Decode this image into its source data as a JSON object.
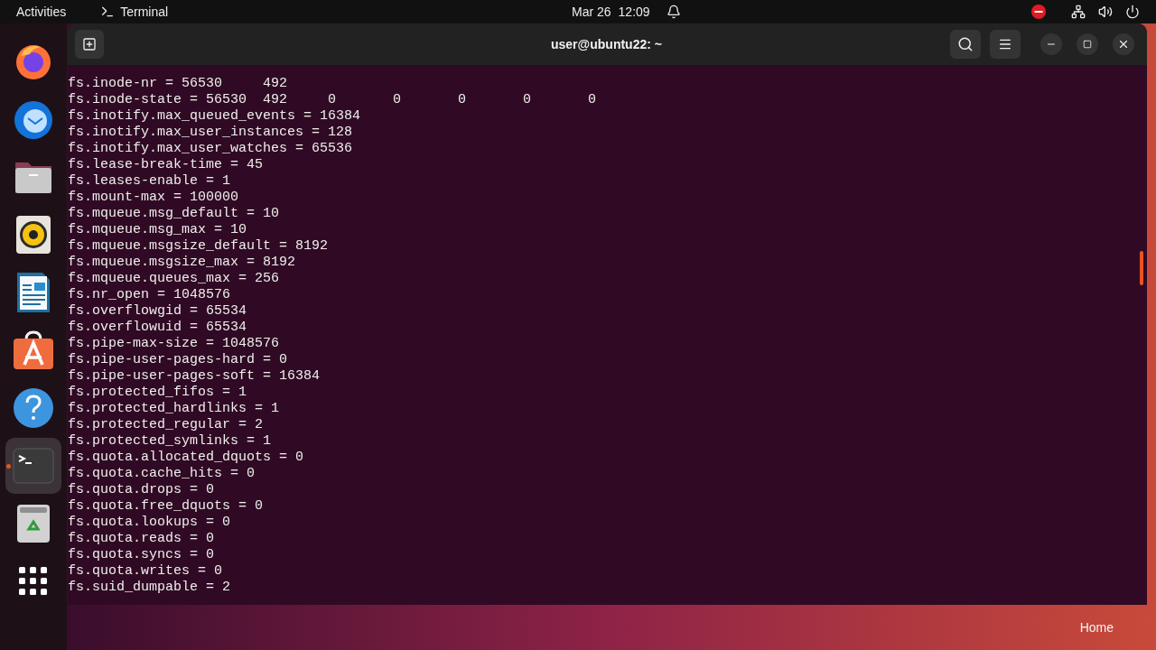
{
  "top_bar": {
    "activities": "Activities",
    "app_menu": "Terminal",
    "date": "Mar 26",
    "time": "12:09"
  },
  "dock": [
    {
      "kind": "firefox",
      "active": false
    },
    {
      "kind": "thunderbird",
      "active": false
    },
    {
      "kind": "files",
      "active": false
    },
    {
      "kind": "rhythmbox",
      "active": false
    },
    {
      "kind": "writer",
      "active": false
    },
    {
      "kind": "software",
      "active": false
    },
    {
      "kind": "help",
      "active": false
    },
    {
      "kind": "terminal",
      "active": true
    },
    {
      "kind": "trash",
      "active": false
    },
    {
      "kind": "apps",
      "active": false
    }
  ],
  "window": {
    "title": "user@ubuntu22: ~",
    "lines": [
      "fs.inode-nr = 56530     492",
      "fs.inode-state = 56530  492     0       0       0       0       0",
      "fs.inotify.max_queued_events = 16384",
      "fs.inotify.max_user_instances = 128",
      "fs.inotify.max_user_watches = 65536",
      "fs.lease-break-time = 45",
      "fs.leases-enable = 1",
      "fs.mount-max = 100000",
      "fs.mqueue.msg_default = 10",
      "fs.mqueue.msg_max = 10",
      "fs.mqueue.msgsize_default = 8192",
      "fs.mqueue.msgsize_max = 8192",
      "fs.mqueue.queues_max = 256",
      "fs.nr_open = 1048576",
      "fs.overflowgid = 65534",
      "fs.overflowuid = 65534",
      "fs.pipe-max-size = 1048576",
      "fs.pipe-user-pages-hard = 0",
      "fs.pipe-user-pages-soft = 16384",
      "fs.protected_fifos = 1",
      "fs.protected_hardlinks = 1",
      "fs.protected_regular = 2",
      "fs.protected_symlinks = 1",
      "fs.quota.allocated_dquots = 0",
      "fs.quota.cache_hits = 0",
      "fs.quota.drops = 0",
      "fs.quota.free_dquots = 0",
      "fs.quota.lookups = 0",
      "fs.quota.reads = 0",
      "fs.quota.syncs = 0",
      "fs.quota.writes = 0",
      "fs.suid_dumpable = 2"
    ]
  },
  "desktop": {
    "home_label": "Home"
  }
}
